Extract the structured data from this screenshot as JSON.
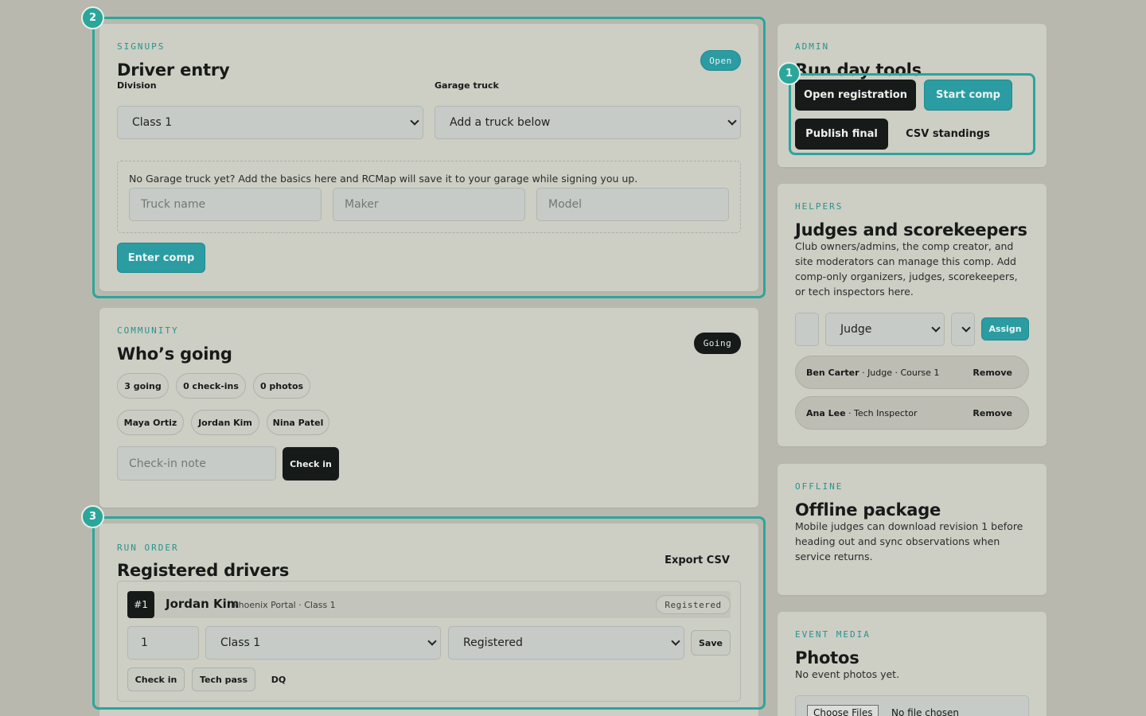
{
  "signups": {
    "eyebrow": "SIGNUPS",
    "title": "Driver entry",
    "status_badge": "Open",
    "division_label": "Division",
    "division_value": "Class 1",
    "truck_label": "Garage truck",
    "truck_value": "Add a truck below",
    "hint": "No Garage truck yet? Add the basics here and RCMap will save it to your garage while signing you up.",
    "truck_name_placeholder": "Truck name",
    "maker_placeholder": "Maker",
    "model_placeholder": "Model",
    "enter_button": "Enter comp"
  },
  "community": {
    "eyebrow": "COMMUNITY",
    "title": "Who’s going",
    "status_badge": "Going",
    "stats": [
      "3 going",
      "0 check-ins",
      "0 photos"
    ],
    "attendees": [
      "Maya Ortiz",
      "Jordan Kim",
      "Nina Patel"
    ],
    "checkin_placeholder": "Check-in note",
    "checkin_button": "Check in"
  },
  "run_order": {
    "eyebrow": "RUN ORDER",
    "title": "Registered drivers",
    "export_button": "Export CSV",
    "drivers": [
      {
        "number": "#1",
        "name": "Jordan Kim",
        "meta": "Phoenix Portal · Class 1",
        "status": "Registered",
        "order_value": "1",
        "class_value": "Class 1",
        "status_value": "Registered",
        "save_button": "Save",
        "checkin_button": "Check in",
        "techpass_button": "Tech pass",
        "dq_button": "DQ"
      }
    ]
  },
  "admin": {
    "eyebrow": "ADMIN",
    "title": "Run day tools",
    "open_registration": "Open registration",
    "start_comp": "Start comp",
    "publish_final": "Publish final",
    "csv_standings": "CSV standings"
  },
  "helpers": {
    "eyebrow": "HELPERS",
    "title": "Judges and scorekeepers",
    "description": "Club owners/admins, the comp creator, and site moderators can manage this comp. Add comp-only organizers, judges, scorekeepers, or tech inspectors here.",
    "role_value": "Judge",
    "assign_button": "Assign",
    "members": [
      {
        "name": "Ben Carter",
        "role": " · Judge · Course 1",
        "remove": "Remove"
      },
      {
        "name": "Ana Lee",
        "role": " · Tech Inspector",
        "remove": "Remove"
      }
    ]
  },
  "offline": {
    "eyebrow": "OFFLINE",
    "title": "Offline package",
    "description": "Mobile judges can download revision 1 before heading out and sync observations when service returns."
  },
  "media": {
    "eyebrow": "EVENT MEDIA",
    "title": "Photos",
    "description": "No event photos yet.",
    "choose_files": "Choose Files",
    "no_file": "No file chosen"
  },
  "markers": [
    "1",
    "2",
    "3"
  ],
  "colors": {
    "accent": "#2a9ca2",
    "highlight": "#2aa69b",
    "dark": "#161a19",
    "card": "#cdcec4",
    "background": "#b9b8ae"
  }
}
